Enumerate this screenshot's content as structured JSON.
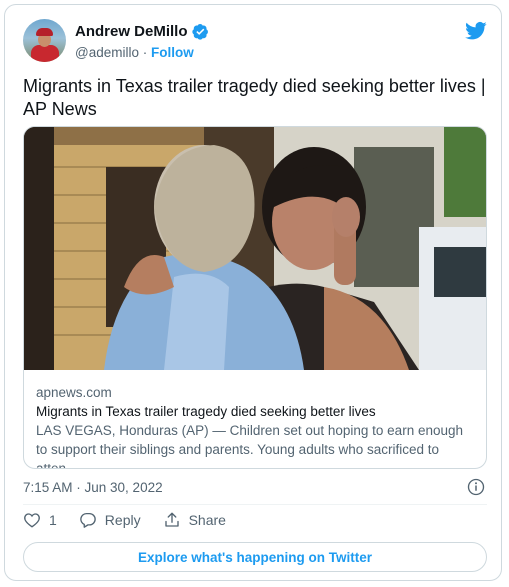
{
  "author": {
    "name": "Andrew DeMillo",
    "handle": "@ademillo",
    "separator": "·",
    "follow_label": "Follow"
  },
  "tweet": {
    "text": "Migrants in Texas trailer tragedy died seeking better lives | AP News"
  },
  "link_card": {
    "domain": "apnews.com",
    "title": "Migrants in Texas trailer tragedy died seeking better lives",
    "description": "LAS VEGAS, Honduras (AP) — Children set out hoping to earn enough to support their siblings and parents. Young adults who sacrificed to atten..."
  },
  "timestamp": "7:15 AM · Jun 30, 2022",
  "actions": {
    "like_count": "1",
    "reply_label": "Reply",
    "share_label": "Share"
  },
  "explore_label": "Explore what's happening on Twitter",
  "colors": {
    "accent": "#1d9bf0",
    "text_primary": "#0f1419",
    "text_secondary": "#536471",
    "border": "#cfd9de"
  },
  "icons": {
    "verified": "verified-badge-icon",
    "brand": "twitter-bird-icon",
    "info": "info-icon",
    "like": "heart-icon",
    "reply": "reply-bubble-icon",
    "share": "share-icon"
  }
}
